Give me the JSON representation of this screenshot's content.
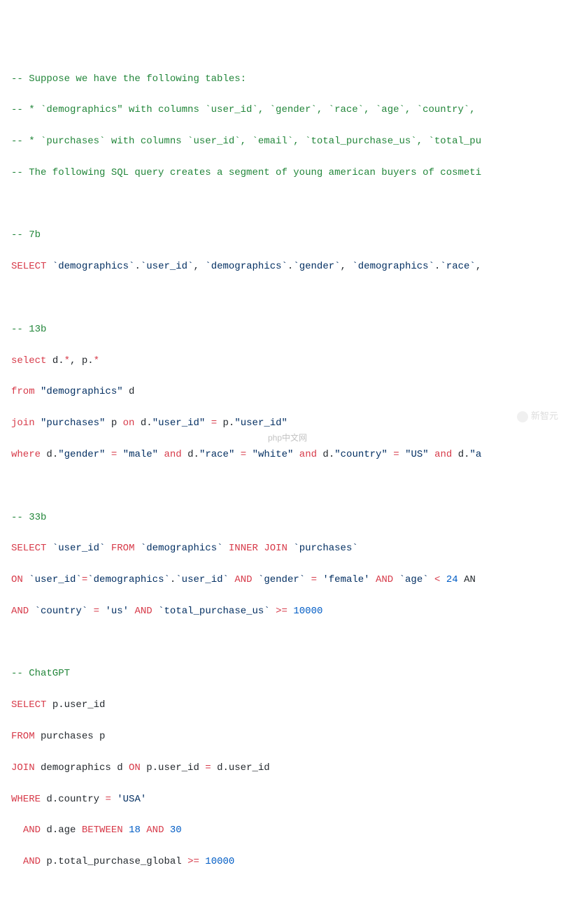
{
  "lines": [
    {
      "t": "comment",
      "parts": [
        {
          "c": "comment",
          "v": "-- Suppose we have the following tables:"
        }
      ]
    },
    {
      "t": "comment",
      "parts": [
        {
          "c": "comment",
          "v": "-- * `demographics\" with columns `user_id`, `gender`, `race`, `age`, `country`,"
        }
      ]
    },
    {
      "t": "comment",
      "parts": [
        {
          "c": "comment",
          "v": "-- * `purchases` with columns `user_id`, `email`, `total_purchase_us`, `total_pu"
        }
      ]
    },
    {
      "t": "comment",
      "parts": [
        {
          "c": "comment",
          "v": "-- The following SQL query creates a segment of young american buyers of cosmeti"
        }
      ]
    },
    {
      "t": "blank",
      "parts": [
        {
          "c": "id",
          "v": " "
        }
      ]
    },
    {
      "t": "comment",
      "parts": [
        {
          "c": "comment",
          "v": "-- 7b"
        }
      ]
    },
    {
      "t": "code",
      "parts": [
        {
          "c": "kw",
          "v": "SELECT"
        },
        {
          "c": "id",
          "v": " "
        },
        {
          "c": "backtick",
          "v": "`demographics`"
        },
        {
          "c": "id",
          "v": "."
        },
        {
          "c": "backtick",
          "v": "`user_id`"
        },
        {
          "c": "id",
          "v": ", "
        },
        {
          "c": "backtick",
          "v": "`demographics`"
        },
        {
          "c": "id",
          "v": "."
        },
        {
          "c": "backtick",
          "v": "`gender`"
        },
        {
          "c": "id",
          "v": ", "
        },
        {
          "c": "backtick",
          "v": "`demographics`"
        },
        {
          "c": "id",
          "v": "."
        },
        {
          "c": "backtick",
          "v": "`race`"
        },
        {
          "c": "id",
          "v": ", "
        }
      ]
    },
    {
      "t": "blank",
      "parts": [
        {
          "c": "id",
          "v": " "
        }
      ]
    },
    {
      "t": "comment",
      "parts": [
        {
          "c": "comment",
          "v": "-- 13b"
        }
      ]
    },
    {
      "t": "code",
      "parts": [
        {
          "c": "kw",
          "v": "select"
        },
        {
          "c": "id",
          "v": " d."
        },
        {
          "c": "op",
          "v": "*"
        },
        {
          "c": "id",
          "v": ", p."
        },
        {
          "c": "op",
          "v": "*"
        }
      ]
    },
    {
      "t": "code",
      "parts": [
        {
          "c": "kw",
          "v": "from"
        },
        {
          "c": "id",
          "v": " "
        },
        {
          "c": "str",
          "v": "\"demographics\""
        },
        {
          "c": "id",
          "v": " d"
        }
      ]
    },
    {
      "t": "code",
      "parts": [
        {
          "c": "kw",
          "v": "join"
        },
        {
          "c": "id",
          "v": " "
        },
        {
          "c": "str",
          "v": "\"purchases\""
        },
        {
          "c": "id",
          "v": " p "
        },
        {
          "c": "kw",
          "v": "on"
        },
        {
          "c": "id",
          "v": " d."
        },
        {
          "c": "str",
          "v": "\"user_id\""
        },
        {
          "c": "id",
          "v": " "
        },
        {
          "c": "op",
          "v": "="
        },
        {
          "c": "id",
          "v": " p."
        },
        {
          "c": "str",
          "v": "\"user_id\""
        }
      ]
    },
    {
      "t": "code",
      "parts": [
        {
          "c": "kw",
          "v": "where"
        },
        {
          "c": "id",
          "v": " d."
        },
        {
          "c": "str",
          "v": "\"gender\""
        },
        {
          "c": "id",
          "v": " "
        },
        {
          "c": "op",
          "v": "="
        },
        {
          "c": "id",
          "v": " "
        },
        {
          "c": "str",
          "v": "\"male\""
        },
        {
          "c": "id",
          "v": " "
        },
        {
          "c": "kw",
          "v": "and"
        },
        {
          "c": "id",
          "v": " d."
        },
        {
          "c": "str",
          "v": "\"race\""
        },
        {
          "c": "id",
          "v": " "
        },
        {
          "c": "op",
          "v": "="
        },
        {
          "c": "id",
          "v": " "
        },
        {
          "c": "str",
          "v": "\"white\""
        },
        {
          "c": "id",
          "v": " "
        },
        {
          "c": "kw",
          "v": "and"
        },
        {
          "c": "id",
          "v": " d."
        },
        {
          "c": "str",
          "v": "\"country\""
        },
        {
          "c": "id",
          "v": " "
        },
        {
          "c": "op",
          "v": "="
        },
        {
          "c": "id",
          "v": " "
        },
        {
          "c": "str",
          "v": "\"US\""
        },
        {
          "c": "id",
          "v": " "
        },
        {
          "c": "kw",
          "v": "and"
        },
        {
          "c": "id",
          "v": " d."
        },
        {
          "c": "str",
          "v": "\"a"
        }
      ]
    },
    {
      "t": "blank",
      "parts": [
        {
          "c": "id",
          "v": " "
        }
      ]
    },
    {
      "t": "comment",
      "parts": [
        {
          "c": "comment",
          "v": "-- 33b"
        }
      ]
    },
    {
      "t": "code",
      "parts": [
        {
          "c": "kw",
          "v": "SELECT"
        },
        {
          "c": "id",
          "v": " "
        },
        {
          "c": "backtick",
          "v": "`user_id`"
        },
        {
          "c": "id",
          "v": " "
        },
        {
          "c": "kw",
          "v": "FROM"
        },
        {
          "c": "id",
          "v": " "
        },
        {
          "c": "backtick",
          "v": "`demographics`"
        },
        {
          "c": "id",
          "v": " "
        },
        {
          "c": "kw",
          "v": "INNER JOIN"
        },
        {
          "c": "id",
          "v": " "
        },
        {
          "c": "backtick",
          "v": "`purchases`"
        }
      ]
    },
    {
      "t": "code",
      "parts": [
        {
          "c": "kw",
          "v": "ON"
        },
        {
          "c": "id",
          "v": " "
        },
        {
          "c": "backtick",
          "v": "`user_id`"
        },
        {
          "c": "op",
          "v": "="
        },
        {
          "c": "backtick",
          "v": "`demographics`"
        },
        {
          "c": "id",
          "v": "."
        },
        {
          "c": "backtick",
          "v": "`user_id`"
        },
        {
          "c": "id",
          "v": " "
        },
        {
          "c": "kw",
          "v": "AND"
        },
        {
          "c": "id",
          "v": " "
        },
        {
          "c": "backtick",
          "v": "`gender`"
        },
        {
          "c": "id",
          "v": " "
        },
        {
          "c": "op",
          "v": "="
        },
        {
          "c": "id",
          "v": " "
        },
        {
          "c": "str",
          "v": "'female'"
        },
        {
          "c": "id",
          "v": " "
        },
        {
          "c": "kw",
          "v": "AND"
        },
        {
          "c": "id",
          "v": " "
        },
        {
          "c": "backtick",
          "v": "`age`"
        },
        {
          "c": "id",
          "v": " "
        },
        {
          "c": "op",
          "v": "<"
        },
        {
          "c": "id",
          "v": " "
        },
        {
          "c": "num",
          "v": "24"
        },
        {
          "c": "id",
          "v": " AN"
        }
      ]
    },
    {
      "t": "code",
      "parts": [
        {
          "c": "kw",
          "v": "AND"
        },
        {
          "c": "id",
          "v": " "
        },
        {
          "c": "backtick",
          "v": "`country`"
        },
        {
          "c": "id",
          "v": " "
        },
        {
          "c": "op",
          "v": "="
        },
        {
          "c": "id",
          "v": " "
        },
        {
          "c": "str",
          "v": "'us'"
        },
        {
          "c": "id",
          "v": " "
        },
        {
          "c": "kw",
          "v": "AND"
        },
        {
          "c": "id",
          "v": " "
        },
        {
          "c": "backtick",
          "v": "`total_purchase_us`"
        },
        {
          "c": "id",
          "v": " "
        },
        {
          "c": "op",
          "v": ">="
        },
        {
          "c": "id",
          "v": " "
        },
        {
          "c": "num",
          "v": "10000"
        }
      ]
    },
    {
      "t": "blank",
      "parts": [
        {
          "c": "id",
          "v": " "
        }
      ]
    },
    {
      "t": "comment",
      "parts": [
        {
          "c": "comment",
          "v": "-- ChatGPT"
        }
      ]
    },
    {
      "t": "code",
      "parts": [
        {
          "c": "kw",
          "v": "SELECT"
        },
        {
          "c": "id",
          "v": " p.user_id"
        }
      ]
    },
    {
      "t": "code",
      "parts": [
        {
          "c": "kw",
          "v": "FROM"
        },
        {
          "c": "id",
          "v": " purchases p"
        }
      ]
    },
    {
      "t": "code",
      "parts": [
        {
          "c": "kw",
          "v": "JOIN"
        },
        {
          "c": "id",
          "v": " demographics d "
        },
        {
          "c": "kw",
          "v": "ON"
        },
        {
          "c": "id",
          "v": " p.user_id "
        },
        {
          "c": "op",
          "v": "="
        },
        {
          "c": "id",
          "v": " d.user_id"
        }
      ]
    },
    {
      "t": "code",
      "parts": [
        {
          "c": "kw",
          "v": "WHERE"
        },
        {
          "c": "id",
          "v": " d.country "
        },
        {
          "c": "op",
          "v": "="
        },
        {
          "c": "id",
          "v": " "
        },
        {
          "c": "str",
          "v": "'USA'"
        }
      ]
    },
    {
      "t": "code",
      "parts": [
        {
          "c": "id",
          "v": "  "
        },
        {
          "c": "kw",
          "v": "AND"
        },
        {
          "c": "id",
          "v": " d.age "
        },
        {
          "c": "kw",
          "v": "BETWEEN"
        },
        {
          "c": "id",
          "v": " "
        },
        {
          "c": "num",
          "v": "18"
        },
        {
          "c": "id",
          "v": " "
        },
        {
          "c": "kw",
          "v": "AND"
        },
        {
          "c": "id",
          "v": " "
        },
        {
          "c": "num",
          "v": "30"
        }
      ]
    },
    {
      "t": "code",
      "parts": [
        {
          "c": "id",
          "v": "  "
        },
        {
          "c": "kw",
          "v": "AND"
        },
        {
          "c": "id",
          "v": " p.total_purchase_global "
        },
        {
          "c": "op",
          "v": ">="
        },
        {
          "c": "id",
          "v": " "
        },
        {
          "c": "num",
          "v": "10000"
        }
      ]
    }
  ],
  "watermark": "新智元",
  "footer": "php中文网"
}
